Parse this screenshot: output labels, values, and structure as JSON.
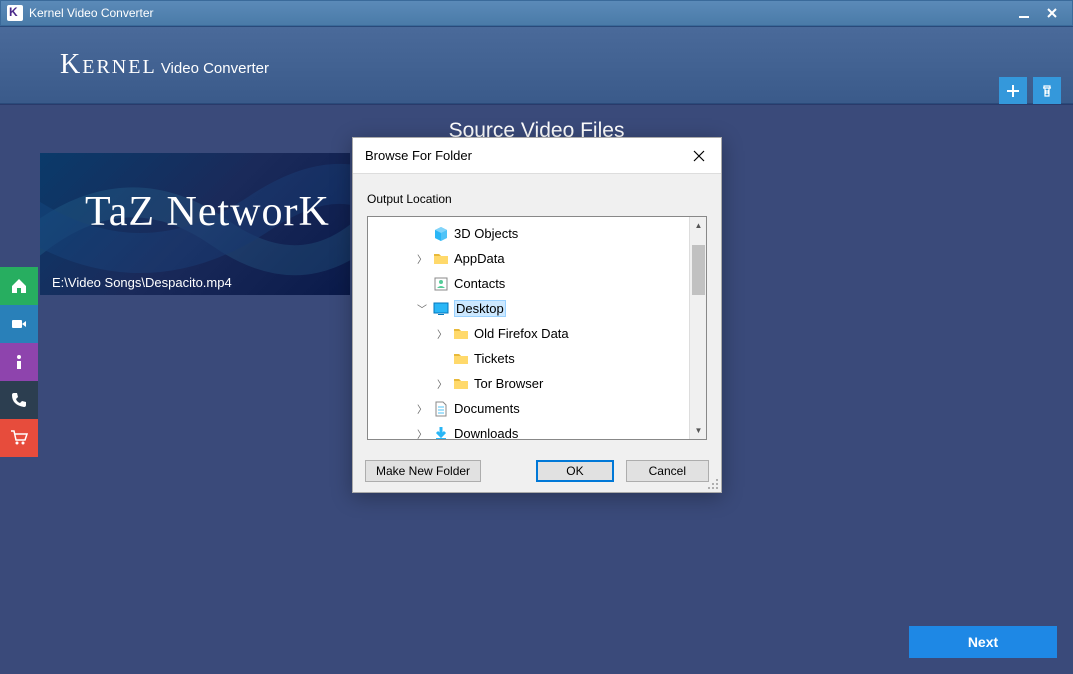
{
  "titlebar": {
    "title": "Kernel Video Converter"
  },
  "brand": {
    "kernel": "Kernel",
    "sub": "Video Converter"
  },
  "source_title": "Source Video Files",
  "thumb": {
    "logo": "TaZ NetworK",
    "caption": "E:\\Video Songs\\Despacito.mp4"
  },
  "next_label": "Next",
  "dialog": {
    "title": "Browse For Folder",
    "label": "Output Location",
    "make_new": "Make New Folder",
    "ok": "OK",
    "cancel": "Cancel",
    "tree": [
      {
        "indent": 2,
        "expander": "",
        "icon": "3d",
        "label": "3D Objects",
        "sel": false
      },
      {
        "indent": 2,
        "expander": ">",
        "icon": "folder",
        "label": "AppData",
        "sel": false
      },
      {
        "indent": 2,
        "expander": "",
        "icon": "contacts",
        "label": "Contacts",
        "sel": false
      },
      {
        "indent": 2,
        "expander": "v",
        "icon": "desktop",
        "label": "Desktop",
        "sel": true
      },
      {
        "indent": 3,
        "expander": ">",
        "icon": "folder",
        "label": "Old Firefox Data",
        "sel": false
      },
      {
        "indent": 3,
        "expander": "",
        "icon": "folder",
        "label": "Tickets",
        "sel": false
      },
      {
        "indent": 3,
        "expander": ">",
        "icon": "folder",
        "label": "Tor Browser",
        "sel": false
      },
      {
        "indent": 2,
        "expander": ">",
        "icon": "doc",
        "label": "Documents",
        "sel": false
      },
      {
        "indent": 2,
        "expander": ">",
        "icon": "download",
        "label": "Downloads",
        "sel": false
      }
    ]
  }
}
